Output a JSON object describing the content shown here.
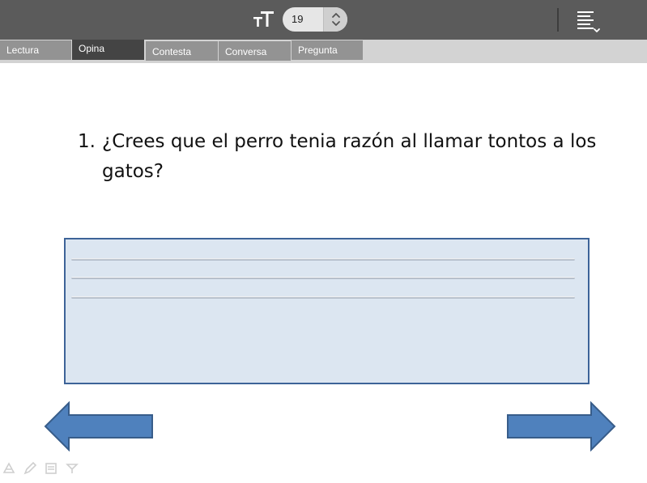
{
  "toolbar": {
    "font_size_value": "19",
    "icons": {
      "font_size": "font-size-icon",
      "stepper_up": "chevron-up-icon",
      "stepper_down": "chevron-down-icon",
      "menu": "menu-list-icon"
    }
  },
  "tabs": [
    {
      "label": "Lectura",
      "active": false
    },
    {
      "label": "Opina",
      "active": true
    },
    {
      "label": "Contesta",
      "active": false
    },
    {
      "label": "Conversa",
      "active": false
    },
    {
      "label": "Pregunta",
      "active": false
    }
  ],
  "question": {
    "number": "1.",
    "text": "¿Crees que el perro tenia razón al llamar tontos a los gatos?"
  },
  "answer_box": {
    "line_count": 3,
    "value": ""
  },
  "navigation": {
    "prev_icon": "left-arrow-icon",
    "next_icon": "right-arrow-icon"
  },
  "bottom_tools": [
    "tool-icon-1",
    "pencil-icon",
    "notes-icon",
    "tool-icon-4"
  ],
  "colors": {
    "toolbar_bg": "#5b5b5b",
    "tab_strip_bg": "#d3d3d3",
    "tab_bg": "#939393",
    "tab_active_bg": "#444444",
    "answer_fill": "#dce6f1",
    "answer_border": "#3d6398",
    "arrow_fill": "#4f81bd",
    "arrow_border": "#385d8a"
  }
}
